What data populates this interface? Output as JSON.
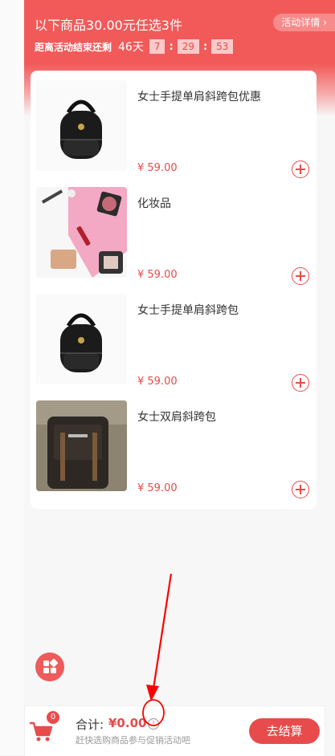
{
  "promo": {
    "title": "以下商品30.00元任选3件",
    "detail_label": "活动详情 ›",
    "countdown_label": "距离活动结束还剩",
    "days": "46天",
    "hours": "7",
    "minutes": "29",
    "seconds": "53",
    "separator": ":"
  },
  "products": [
    {
      "name": "女士手提单肩斜跨包优惠",
      "price": "¥ 59.00",
      "image": "black-backpack"
    },
    {
      "name": "化妆品",
      "price": "¥ 59.00",
      "image": "cosmetics"
    },
    {
      "name": "女士手提单肩斜跨包",
      "price": "¥ 59.00",
      "image": "black-backpack"
    },
    {
      "name": "女士双肩斜跨包",
      "price": "¥ 59.00",
      "image": "brown-backpack"
    }
  ],
  "bottom_bar": {
    "cart_count": "0",
    "total_label": "合计:",
    "total_value": "¥0.00",
    "hint": "赶快选购商品参与促销活动吧",
    "checkout_label": "去结算"
  },
  "colors": {
    "accent": "#e84b4b",
    "banner": "#f25a5a",
    "annotation": "#ff0000"
  }
}
